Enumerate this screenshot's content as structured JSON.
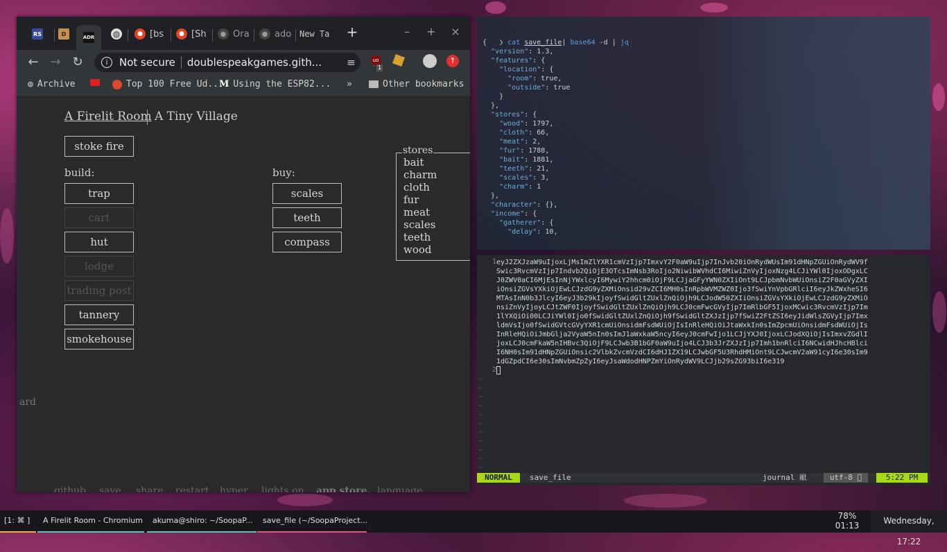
{
  "browser": {
    "tabs": [
      {
        "favicon": "RS",
        "label": ""
      },
      {
        "favicon": "D",
        "label": ""
      },
      {
        "favicon": "ADR",
        "label": ""
      },
      {
        "favicon": "globe",
        "label": ""
      },
      {
        "favicon": "reddit",
        "label": "[bs"
      },
      {
        "favicon": "reddit",
        "label": "[Sh"
      },
      {
        "favicon": "github",
        "label": "Ora"
      },
      {
        "favicon": "github",
        "label": "ado"
      },
      {
        "favicon": "",
        "label": "New Ta"
      }
    ],
    "new_tab_glyph": "+",
    "window_controls": {
      "minimize": "–",
      "maximize": "+",
      "close": "×"
    },
    "omnibox": {
      "security": "Not secure",
      "url": "doublespeakgames.gith..."
    },
    "extension_badge": "1",
    "bookmarks": [
      {
        "icon": "globe",
        "label": "Archive"
      },
      {
        "icon": "youtube",
        "label": ""
      },
      {
        "icon": "udemy",
        "label": "Top 100 Free Ud..."
      },
      {
        "icon": "medium",
        "label": "Using the ESP82..."
      }
    ],
    "bookmarks_more": "»",
    "other_bookmarks": "Other bookmarks"
  },
  "game": {
    "locations": {
      "current": "A Firelit Room",
      "other": "A Tiny Village"
    },
    "stoke_button": "stoke fire",
    "build_label": "build:",
    "build_buttons": [
      "trap",
      "cart",
      "hut",
      "lodge",
      "trading post",
      "tannery",
      "smokehouse"
    ],
    "buy_label": "buy:",
    "buy_buttons": [
      "scales",
      "teeth",
      "compass"
    ],
    "stores_title": "stores",
    "stores": [
      "bait",
      "charm",
      "cloth",
      "fur",
      "meat",
      "scales",
      "teeth",
      "wood"
    ],
    "side_text": "ard",
    "footer": [
      "github.",
      "save.",
      "share.",
      "restart.",
      "hyper.",
      "lights on.",
      "app store.",
      "language."
    ]
  },
  "terminal": {
    "prompt": "❯",
    "cmd_cat": "cat",
    "cmd_file": "save_file",
    "cmd_pipe1": "|",
    "cmd_b64": "base64",
    "cmd_flag": "-d",
    "cmd_pipe2": "|",
    "cmd_jq": "jq",
    "json_lines": [
      "{",
      "  \"version\": 1.3,",
      "  \"features\": {",
      "    \"location\": {",
      "      \"room\": true,",
      "      \"outside\": true",
      "    }",
      "  },",
      "  \"stores\": {",
      "    \"wood\": 1797,",
      "    \"cloth\": 66,",
      "    \"meat\": 2,",
      "    \"fur\": 1788,",
      "    \"bait\": 1881,",
      "    \"teeth\": 21,",
      "    \"scales\": 3,",
      "    \"charm\": 1",
      "  },",
      "  \"character\": {},",
      "  \"income\": {",
      "    \"gatherer\": {",
      "      \"delay\": 10,"
    ]
  },
  "vim": {
    "line_numbers": [
      "1",
      "2"
    ],
    "code_lines": [
      "eyJ2ZXJzaW9uIjoxLjMsImZlYXR1cmVzIjp7ImxvY2F0aW9uIjp7InJvb20iOnRydWUsIm91dHNpZGUiOnRydWV9f",
      "Swic3RvcmVzIjp7Indvb2QiOjE3OTcsImNsb3RoIjo2NiwibWVhdCI6MiwiZnVyIjoxNzg4LCJiYWl0IjoxODgxLC",
      "J0ZWV0aCI6MjEsInNjYWxlcyI6MywiY2hhcm0iOjF9LCJjaGFyYWN0ZXIiOnt9LCJpbmNvbWUiOnsiZ2F0aGVyZXI",
      "iOnsiZGVsYXkiOjEwLCJzdG9yZXMiOnsid29vZCI6MH0sInRpbWVMZWZ0Ijo3fSwiYnVpbGRlciI6eyJkZWxheSI6",
      "MTAsInN0b3JlcyI6eyJ3b29kIjoyfSwidGltZUxlZnQiOjh9LCJodW50ZXIiOnsiZGVsYXkiOjEwLCJzdG9yZXMiO",
      "nsiZnVyIjoyLCJtZWF0IjoyfSwidGltZUxlZnQiOjh9LCJ0cmFwcGVyIjp7ImRlbGF5IjoxMCwic3RvcmVzIjp7Im",
      "1lYXQiOi00LCJiYWl0Ijo0fSwidGltZUxlZnQiOjh9fSwidGltZXJzIjp7fSwiZ2FtZSI6eyJidWlsZGVyIjp7Imx",
      "ldmVsIjo0fSwidGVtcGVyYXR1cmUiOnsidmFsdWUiOjIsInRleHQiOiJtaWxkIn0sImZpcmUiOnsidmFsdWUiOjIs",
      "InRleHQiOiJmbGlja2VyaW5nIn0sImJ1aWxkaW5ncyI6eyJ0cmFwIjo1LCJjYXJ0IjoxLCJodXQiOjIsImxvZGdlI",
      "joxLCJ0cmFkaW5nIHBvc3QiOjF9LCJwb3B1bGF0aW9uIjo4LCJ3b3JrZXJzIjp7Imh1bnRlciI6NCwidHJhcHBlci",
      "I6NH0sIm91dHNpZGUiOnsic2VlbkZvcmVzdCI6dHJ1ZX19LCJwbGF5U3RhdHMiOnt9LCJwcmV2aW91cyI6e30sIm9",
      "1dGZpdCI6e30sImNvbmZpZyI6eyJsaWdodHNPZmYiOnRydWV9LCJjb29sZG93biI6e319"
    ],
    "tilde": "~",
    "status": {
      "mode": "NORMAL",
      "file": "save_file",
      "filetype": "journal 𣬈",
      "encoding": "utf-8 𫕣",
      "time": "5:22 PM"
    }
  },
  "taskbar": {
    "workspace": "[1: ⌘ ]",
    "tasks": [
      {
        "label": "A Firelit Room - Chromium",
        "color": "#58c4b0"
      },
      {
        "label": "akuma@shiro: ~/SoopaP...",
        "color": "#58c4b0"
      },
      {
        "label": "save_file (~/SoopaProject...",
        "color": "#e05a7a"
      }
    ],
    "battery_percent": "78%",
    "battery_time": "01:13",
    "clock": "Wednesday, 17:22"
  }
}
